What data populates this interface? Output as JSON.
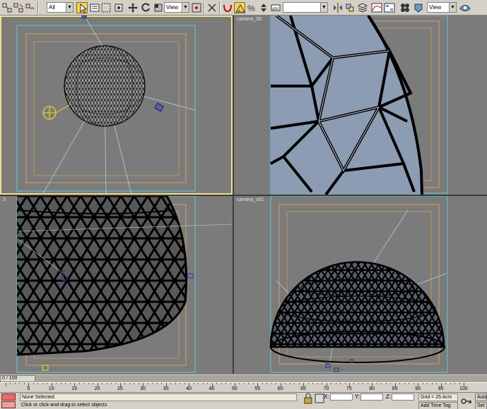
{
  "toolbar": {
    "selection_filter": "All",
    "reference_coord": "View",
    "named_selection": "",
    "render_view": "View"
  },
  "viewports": {
    "top_left": {
      "label": ""
    },
    "top_right": {
      "label": "camera_05"
    },
    "bottom_left": {
      "label": "3"
    },
    "bottom_right": {
      "label": "camera_s01"
    }
  },
  "timeline": {
    "slider_label": "0 / 100",
    "ticks": [
      "5",
      "10",
      "15",
      "20",
      "25",
      "30",
      "35",
      "40",
      "45",
      "50",
      "55",
      "60",
      "65",
      "70",
      "75",
      "80",
      "85",
      "90",
      "95",
      "100"
    ]
  },
  "status": {
    "selection": "None Selected",
    "prompt": "Click or click-and-drag to select objects",
    "x_label": "X:",
    "y_label": "Y:",
    "z_label": "Z:",
    "grid": "Grid = 25.4cm",
    "add_time_tag": "Add Time Tag",
    "auto_key": "Auto",
    "set_key": "Set K"
  },
  "colors": {
    "viewport_bg": "#7b7b7b",
    "active_border": "#f1e28e",
    "safe_frame_orange": "#d9a05a",
    "safe_frame_cyan": "#61c8d6",
    "wire": "#000000",
    "glass": "#8c9cb2"
  }
}
